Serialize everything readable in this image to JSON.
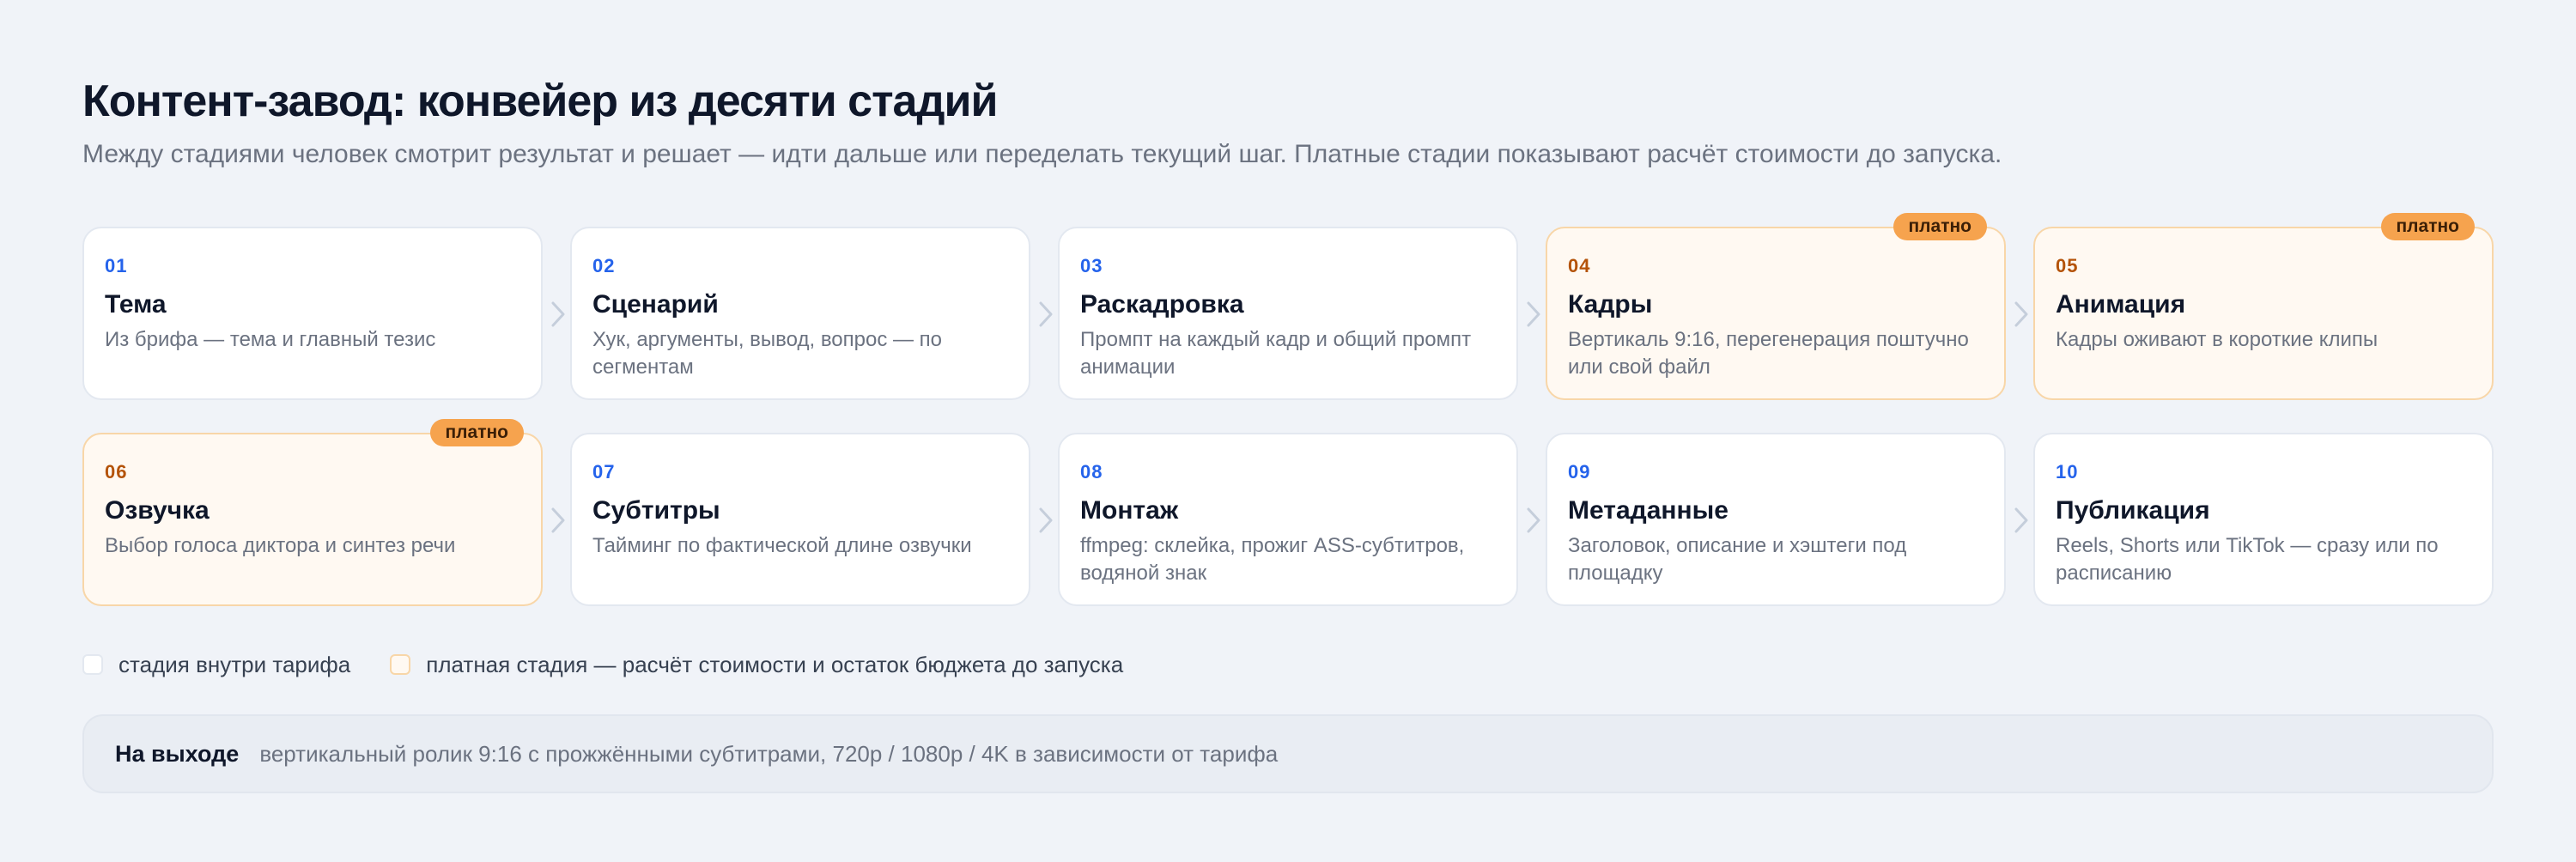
{
  "header": {
    "title": "Контент-завод: конвейер из десяти стадий",
    "subtitle": "Между стадиями человек смотрит результат и решает — идти дальше или переделать текущий шаг. Платные стадии показывают расчёт стоимости до запуска."
  },
  "paid_badge": "платно",
  "rows": [
    [
      {
        "num": "01",
        "name": "Тема",
        "desc": "Из брифа — тема и главный тезис",
        "paid": false
      },
      {
        "num": "02",
        "name": "Сценарий",
        "desc": "Хук, аргументы, вывод, вопрос — по сегментам",
        "paid": false
      },
      {
        "num": "03",
        "name": "Раскадровка",
        "desc": "Промпт на каждый кадр и общий промпт анимации",
        "paid": false
      },
      {
        "num": "04",
        "name": "Кадры",
        "desc": "Вертикаль 9:16, перегенерация поштучно или свой файл",
        "paid": true
      },
      {
        "num": "05",
        "name": "Анимация",
        "desc": "Кадры оживают в короткие клипы",
        "paid": true
      }
    ],
    [
      {
        "num": "06",
        "name": "Озвучка",
        "desc": "Выбор голоса диктора и синтез речи",
        "paid": true
      },
      {
        "num": "07",
        "name": "Субтитры",
        "desc": "Тайминг по фактической длине озвучки",
        "paid": false
      },
      {
        "num": "08",
        "name": "Монтаж",
        "desc": "ffmpeg: склейка, прожиг ASS-субтитров, водяной знак",
        "paid": false
      },
      {
        "num": "09",
        "name": "Метаданные",
        "desc": "Заголовок, описание и хэштеги под площадку",
        "paid": false
      },
      {
        "num": "10",
        "name": "Публикация",
        "desc": "Reels, Shorts или TikTok — сразу или по расписанию",
        "paid": false
      }
    ]
  ],
  "legend": {
    "free": "стадия внутри тарифа",
    "paid": "платная стадия — расчёт стоимости и остаток бюджета до запуска"
  },
  "output": {
    "label": "На выходе",
    "text": "вертикальный ролик 9:16 с прожжёнными субтитрами, 720p / 1080p / 4K в зависимости от тарифа"
  },
  "colors": {
    "accent_blue": "#2563eb",
    "paid_accent": "#b45309",
    "paid_badge": "#f6a34e",
    "paid_bg": "#fff9f2"
  }
}
